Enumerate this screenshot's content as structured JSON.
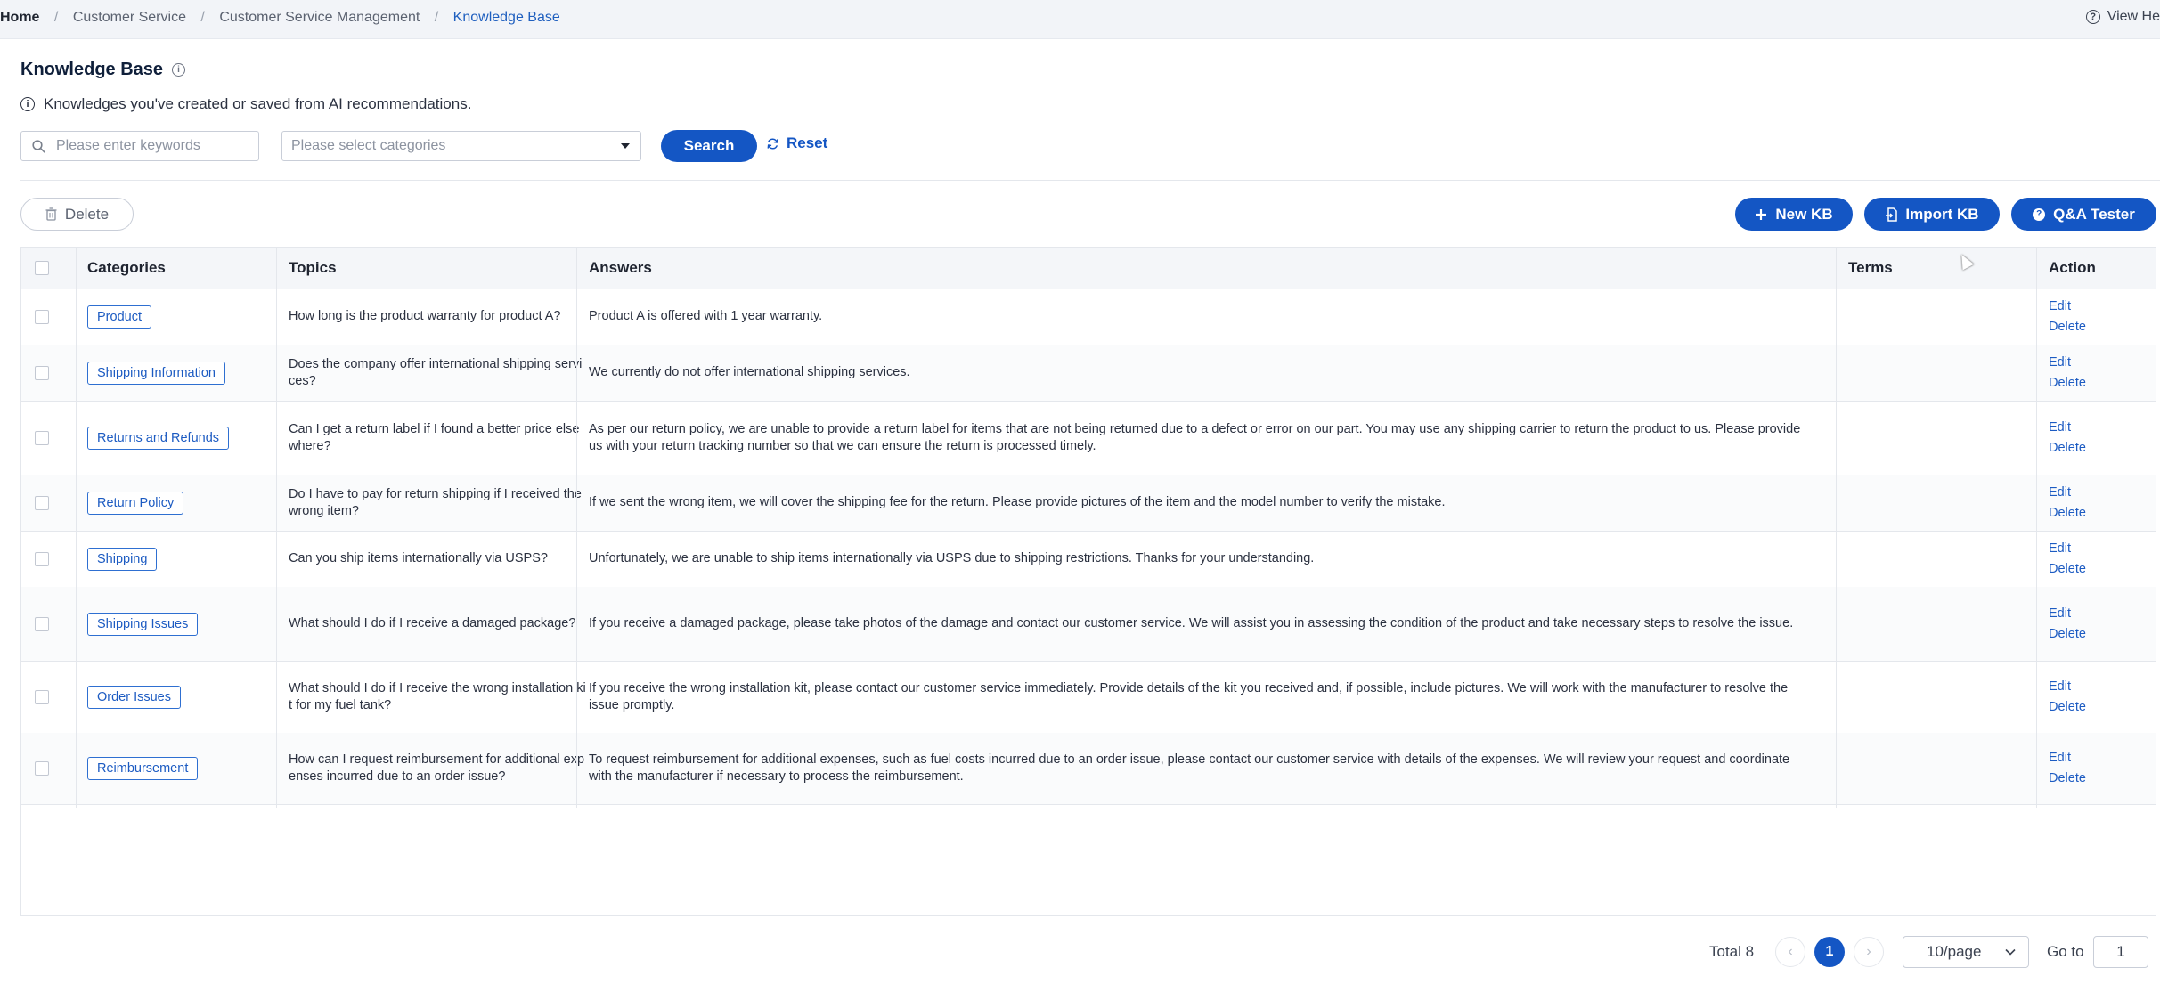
{
  "breadcrumb": {
    "home": "Home",
    "items": [
      "Customer Service",
      "Customer Service Management"
    ],
    "current": "Knowledge Base",
    "separator": "/"
  },
  "view_help": "View He",
  "page": {
    "title": "Knowledge Base",
    "subtitle": "Knowledges you've created or saved from AI recommendations."
  },
  "filters": {
    "keyword_placeholder": "Please enter keywords",
    "category_placeholder": "Please select categories",
    "search_label": "Search",
    "reset_label": "Reset"
  },
  "toolbar": {
    "delete_label": "Delete",
    "new_kb_label": "New KB",
    "import_kb_label": "Import KB",
    "qa_tester_label": "Q&A Tester"
  },
  "table": {
    "columns": [
      "Categories",
      "Topics",
      "Answers",
      "Terms",
      "Action"
    ],
    "edit_label": "Edit",
    "delete_label": "Delete",
    "rows": [
      {
        "category": "Product",
        "topic": "How long is the product warranty for product A?",
        "answer": "Product A is offered with 1 year warranty."
      },
      {
        "category": "Shipping Information",
        "topic": "Does the company offer international shipping services?",
        "answer": "We currently do not offer international shipping services."
      },
      {
        "category": "Returns and Refunds",
        "topic": "Can I get a return label if I found a better price elsewhere?",
        "answer": "As per our return policy, we are unable to provide a return label for items that are not being returned due to a defect or error on our part. You may use any shipping carrier to return the product to us. Please provide us with your return tracking number so that we can ensure the return is processed timely."
      },
      {
        "category": "Return Policy",
        "topic": "Do I have to pay for return shipping if I received the wrong item?",
        "answer": "If we sent the wrong item, we will cover the shipping fee for the return. Please provide pictures of the item and the model number to verify the mistake."
      },
      {
        "category": "Shipping",
        "topic": "Can you ship items internationally via USPS?",
        "answer": "Unfortunately, we are unable to ship items internationally via USPS due to shipping restrictions. Thanks for your understanding."
      },
      {
        "category": "Shipping Issues",
        "topic": "What should I do if I receive a damaged package?",
        "answer": "If you receive a damaged package, please take photos of the damage and contact our customer service. We will assist you in assessing the condition of the product and take necessary steps to resolve the issue."
      },
      {
        "category": "Order Issues",
        "topic": "What should I do if I receive the wrong installation kit for my fuel tank?",
        "answer": "If you receive the wrong installation kit, please contact our customer service immediately. Provide details of the kit you received and, if possible, include pictures. We will work with the manufacturer to resolve the issue promptly."
      },
      {
        "category": "Reimbursement",
        "topic": "How can I request reimbursement for additional expenses incurred due to an order issue?",
        "answer": "To request reimbursement for additional expenses, such as fuel costs incurred due to an order issue, please contact our customer service with details of the expenses. We will review your request and coordinate with the manufacturer if necessary to process the reimbursement."
      }
    ]
  },
  "pagination": {
    "total_label": "Total 8",
    "prev": "‹",
    "current_page": "1",
    "next": "›",
    "page_size": "10/page",
    "goto_label": "Go to",
    "goto_value": "1"
  },
  "colors": {
    "primary": "#1456c4",
    "link": "#1c5bc2",
    "header_bg": "#f2f4f8"
  }
}
